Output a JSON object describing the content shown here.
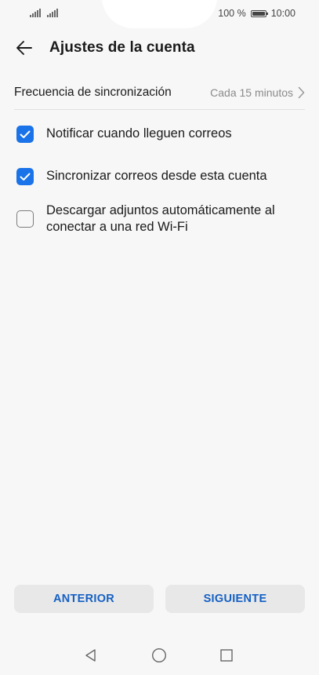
{
  "status_bar": {
    "battery_text": "100 %",
    "time": "10:00",
    "battery_level": 1.0
  },
  "header": {
    "title": "Ajustes de la cuenta",
    "back_icon": "arrow-left-icon"
  },
  "sync_frequency": {
    "label": "Frecuencia de sincronización",
    "value": "Cada 15 minutos",
    "icon": "chevron-right-icon"
  },
  "options": [
    {
      "label": "Notificar cuando lleguen correos",
      "checked": true
    },
    {
      "label": "Sincronizar correos desde esta cuenta",
      "checked": true
    },
    {
      "label": "Descargar adjuntos automáticamente al conectar a una red Wi-Fi",
      "checked": false
    }
  ],
  "buttons": {
    "previous": "ANTERIOR",
    "next": "SIGUIENTE"
  },
  "colors": {
    "accent": "#1a73e8",
    "button_text": "#1560c4",
    "background": "#f7f7f7"
  },
  "nav_icons": [
    "back-triangle-icon",
    "home-circle-icon",
    "recents-square-icon"
  ]
}
